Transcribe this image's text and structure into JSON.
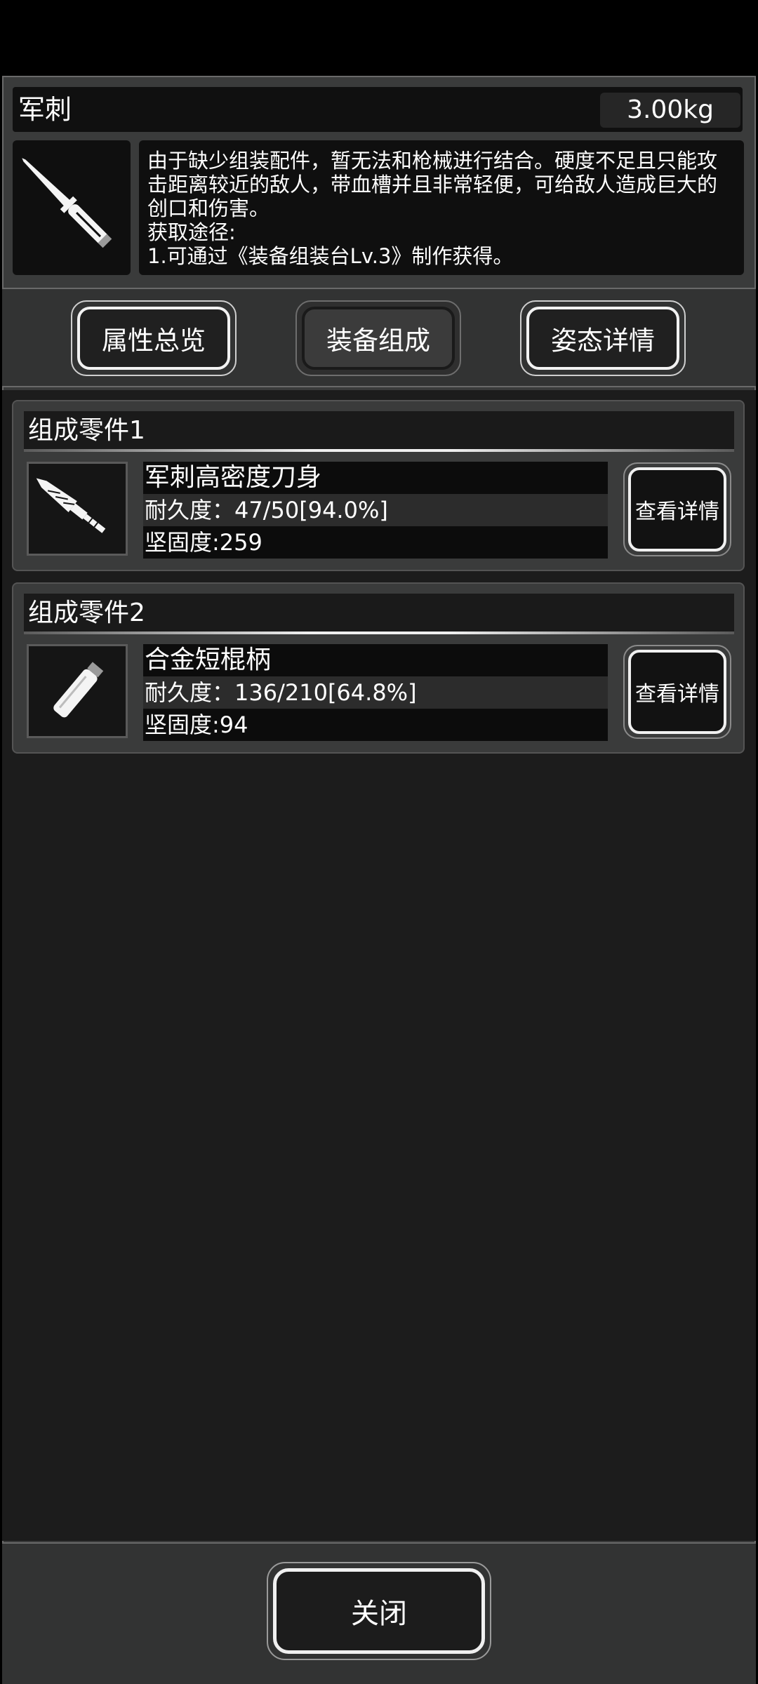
{
  "item": {
    "name": "军刺",
    "weight": "3.00kg",
    "icon": "bayonet-icon",
    "description_lines": [
      "由于缺少组装配件，暂无法和枪械进行结合。硬度不足且只能攻",
      "击距离较近的敌人，带血槽并且非常轻便，可给敌人造成巨大的",
      "创口和伤害。",
      "获取途径:",
      "1.可通过《装备组装台Lv.3》制作获得。"
    ]
  },
  "tabs": [
    {
      "label": "属性总览",
      "active": false
    },
    {
      "label": "装备组成",
      "active": true
    },
    {
      "label": "姿态详情",
      "active": false
    }
  ],
  "parts": [
    {
      "title": "组成零件1",
      "icon": "blade-icon",
      "name": "军刺高密度刀身",
      "durability": "耐久度：47/50[94.0%]",
      "hardness": "坚固度:259",
      "button": "查看详情"
    },
    {
      "title": "组成零件2",
      "icon": "short-handle-icon",
      "name": "合金短棍柄",
      "durability": "耐久度：136/210[64.8%]",
      "hardness": "坚固度:94",
      "button": "查看详情"
    }
  ],
  "close_label": "关闭"
}
